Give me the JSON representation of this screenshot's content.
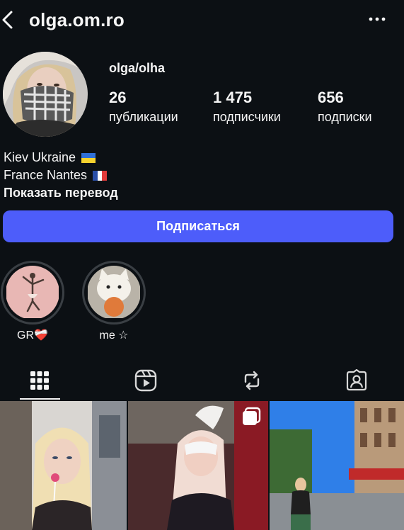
{
  "header": {
    "username": "olga.om.ro",
    "back_icon": "chevron-left-icon",
    "more_icon": "ellipsis-icon"
  },
  "profile": {
    "display_name": "olga/olha",
    "stats": [
      {
        "value": "26",
        "label": "публикации"
      },
      {
        "value": "1 475",
        "label": "подписчики"
      },
      {
        "value": "656",
        "label": "подписки"
      }
    ]
  },
  "bio": {
    "line1": "Kiev Ukraine",
    "line1_flag": "ukraine-flag-icon",
    "line2": "France Nantes",
    "line2_flag": "france-flag-icon",
    "translate": "Показать перевод"
  },
  "follow_button": {
    "label": "Подписаться",
    "color": "#4d5dfa"
  },
  "highlights": [
    {
      "label": "GR❤️‍🩹"
    },
    {
      "label": "me ☆"
    }
  ],
  "tabs": [
    {
      "icon": "grid-icon",
      "active": true
    },
    {
      "icon": "reels-icon",
      "active": false
    },
    {
      "icon": "repost-icon",
      "active": false
    },
    {
      "icon": "tagged-icon",
      "active": false
    }
  ],
  "colors": {
    "background": "#0c1014",
    "text": "#f5f5f5",
    "accent": "#4d5dfa"
  }
}
